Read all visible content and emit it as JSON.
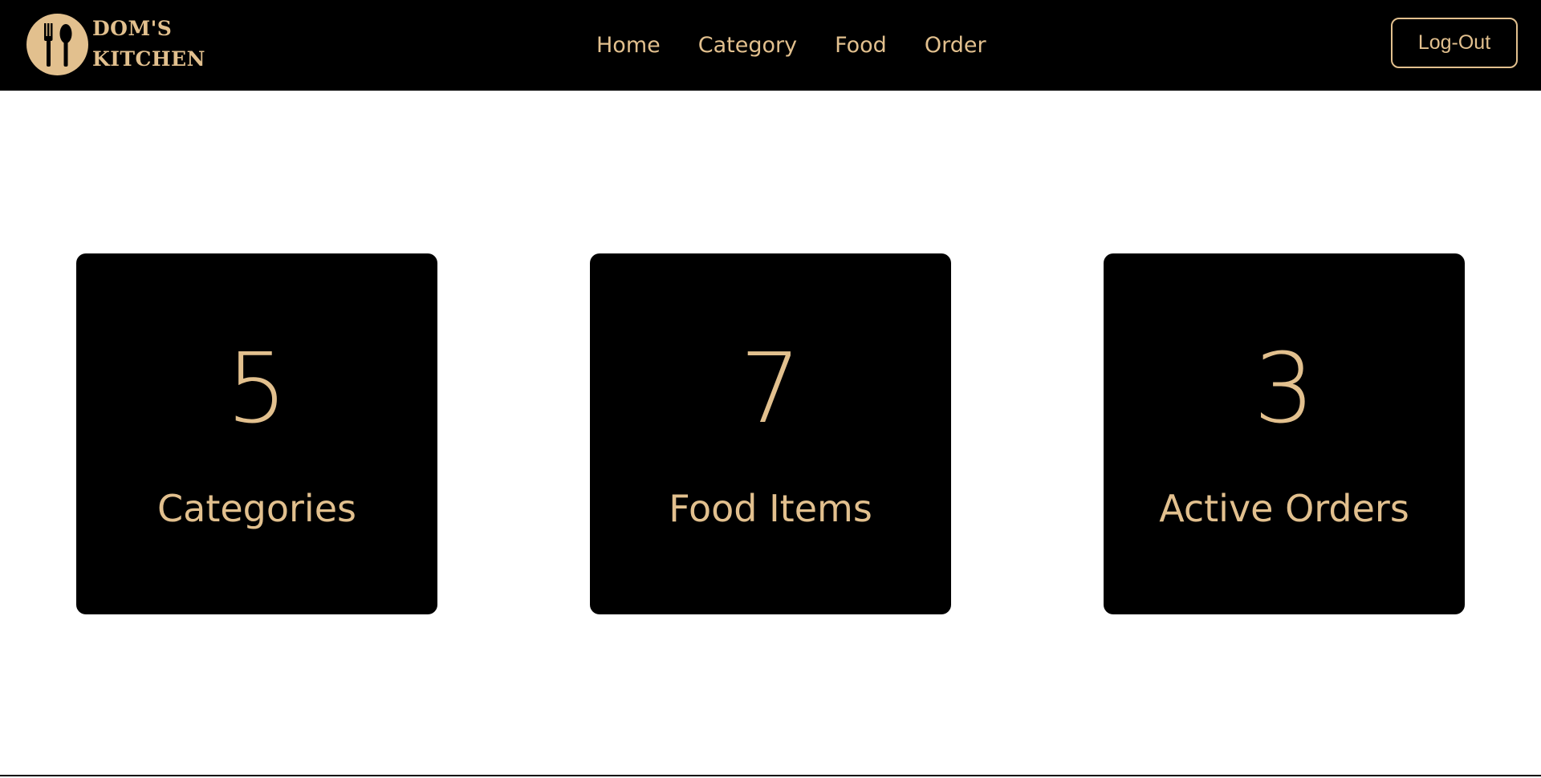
{
  "brand": {
    "line1": "DOM'S",
    "line2": "KITCHEN",
    "icon": "fork-spoon-icon"
  },
  "nav": {
    "links": [
      {
        "label": "Home"
      },
      {
        "label": "Category"
      },
      {
        "label": "Food"
      },
      {
        "label": "Order"
      }
    ],
    "logout_label": "Log-Out"
  },
  "stats": [
    {
      "value": "5",
      "label": "Categories"
    },
    {
      "value": "7",
      "label": "Food Items"
    },
    {
      "value": "3",
      "label": "Active Orders"
    }
  ],
  "colors": {
    "accent": "#e2c08e",
    "background": "#000000",
    "page": "#ffffff"
  }
}
